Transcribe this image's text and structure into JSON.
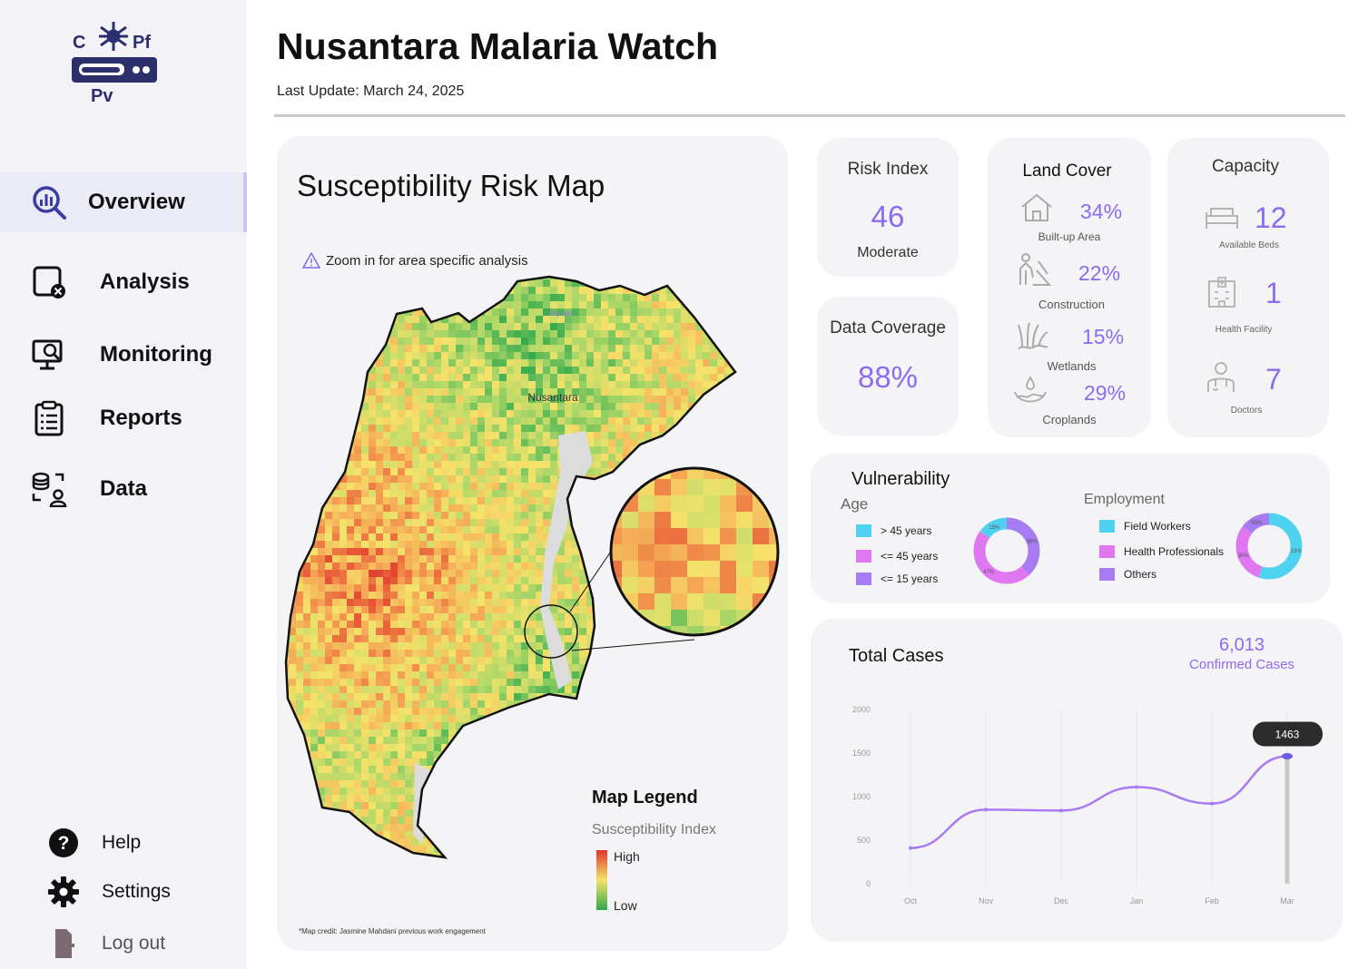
{
  "logo": {
    "letter_c": "C",
    "letter_pf": "Pf",
    "letter_pv": "Pv"
  },
  "nav": [
    {
      "label": "Overview",
      "icon": "search-chart-icon",
      "active": true
    },
    {
      "label": "Analysis",
      "icon": "analysis-icon"
    },
    {
      "label": "Monitoring",
      "icon": "monitoring-icon"
    },
    {
      "label": "Reports",
      "icon": "clipboard-icon"
    },
    {
      "label": "Data",
      "icon": "database-user-icon"
    }
  ],
  "footer_nav": [
    {
      "label": "Help",
      "icon": "help-icon"
    },
    {
      "label": "Settings",
      "icon": "gear-icon"
    },
    {
      "label": "Log out",
      "icon": "logout-icon"
    }
  ],
  "header": {
    "title": "Nusantara Malaria Watch",
    "last_update": "Last Update: March 24, 2025"
  },
  "map": {
    "title": "Susceptibility Risk Map",
    "hint": "Zoom in for area specific analysis",
    "place_labels": [
      "Sepaku",
      "Nusantara"
    ],
    "legend_title": "Map Legend",
    "legend_subtitle": "Susceptibility Index",
    "legend_high": "High",
    "legend_low": "Low",
    "credit": "*Map credit: Jasmine Mahdani previous work engagement"
  },
  "risk": {
    "title": "Risk Index",
    "value": "46",
    "level": "Moderate"
  },
  "coverage": {
    "title": "Data Coverage",
    "value": "88%"
  },
  "land_cover": {
    "title": "Land Cover",
    "items": [
      {
        "pct": "34%",
        "label": "Built-up Area",
        "icon": "house-icon"
      },
      {
        "pct": "22%",
        "label": "Construction",
        "icon": "construction-worker-icon"
      },
      {
        "pct": "15%",
        "label": "Wetlands",
        "icon": "wetland-grass-icon"
      },
      {
        "pct": "29%",
        "label": "Croplands",
        "icon": "irrigation-icon"
      }
    ]
  },
  "capacity": {
    "title": "Capacity",
    "items": [
      {
        "value": "12",
        "label": "Available Beds",
        "icon": "bed-icon"
      },
      {
        "value": "1",
        "label": "Health Facility",
        "icon": "hospital-icon"
      },
      {
        "value": "7",
        "label": "Doctors",
        "icon": "doctor-icon"
      }
    ]
  },
  "vulnerability": {
    "title": "Vulnerability",
    "age": {
      "title": "Age",
      "items": [
        {
          "label": "> 45 years",
          "color": "#4fd2f0"
        },
        {
          "label": "<= 45 years",
          "color": "#df78f0"
        },
        {
          "label": "<= 15 years",
          "color": "#a77bf2"
        }
      ],
      "slice_labels": [
        "38%",
        "47%",
        "15%"
      ],
      "fractions": [
        0.38,
        0.47,
        0.15
      ]
    },
    "employment": {
      "title": "Employment",
      "items": [
        {
          "label": "Field Workers",
          "color": "#4fd2f0"
        },
        {
          "label": "Health Professionals",
          "color": "#df78f0"
        },
        {
          "label": "Others",
          "color": "#a77bf2"
        }
      ],
      "slice_labels": [
        "15%",
        "30%",
        "55%"
      ],
      "fractions": [
        0.55,
        0.3,
        0.15
      ]
    }
  },
  "cases": {
    "title": "Total Cases",
    "total": "6,013",
    "total_label": "Confirmed Cases",
    "tooltip": "1463"
  },
  "chart_data": {
    "type": "line",
    "categories": [
      "Oct",
      "Nov",
      "Dec",
      "Jan",
      "Feb",
      "Mar"
    ],
    "y_ticks": [
      "0",
      "500",
      "1000",
      "1500",
      "2000"
    ],
    "ylim": [
      0,
      2000
    ],
    "series": [
      {
        "values": [
          410,
          850,
          840,
          1110,
          920,
          1463
        ]
      }
    ],
    "color": "#a77bf2",
    "tooltip_value": 1463
  },
  "colors": {
    "accent": "#8b6cf0",
    "sidebar_bg": "#f2f2f7",
    "card_bg": "#f4f4f7",
    "risk_high": "#e0342a",
    "risk_low": "#2ea84a"
  }
}
